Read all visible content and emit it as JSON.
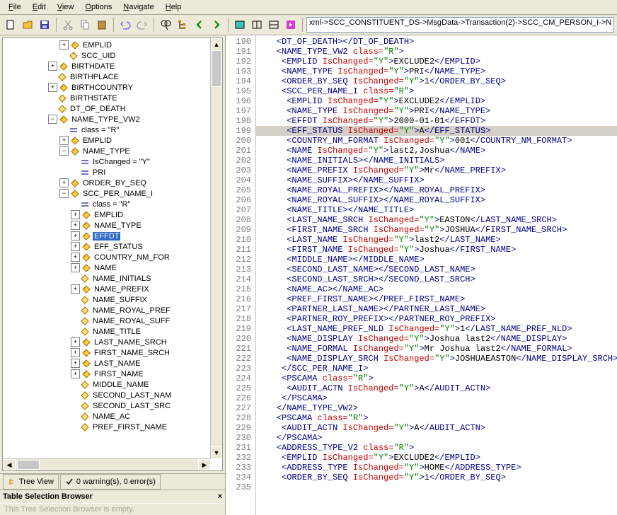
{
  "menubar": [
    "File",
    "Edit",
    "View",
    "Options",
    "Navigate",
    "Help"
  ],
  "breadcrumb": "xml->SCC_CONSTITUENT_DS->MsgData->Transaction(2)->SCC_CM_PERSON_I->N",
  "tree": [
    {
      "indent": 5,
      "tw": "+",
      "ic": "tag",
      "label": "EMPLID"
    },
    {
      "indent": 5,
      "tw": "",
      "ic": "leaf",
      "label": "SCC_UID"
    },
    {
      "indent": 4,
      "tw": "+",
      "ic": "tag",
      "label": "BIRTHDATE"
    },
    {
      "indent": 4,
      "tw": "",
      "ic": "leaf",
      "label": "BIRTHPLACE"
    },
    {
      "indent": 4,
      "tw": "+",
      "ic": "tag",
      "label": "BIRTHCOUNTRY"
    },
    {
      "indent": 4,
      "tw": "",
      "ic": "leaf",
      "label": "BIRTHSTATE"
    },
    {
      "indent": 4,
      "tw": "",
      "ic": "leaf",
      "label": "DT_OF_DEATH"
    },
    {
      "indent": 4,
      "tw": "-",
      "ic": "tag",
      "label": "NAME_TYPE_VW2"
    },
    {
      "indent": 5,
      "tw": "",
      "ic": "eq",
      "label": "class = \"R\""
    },
    {
      "indent": 5,
      "tw": "+",
      "ic": "tag",
      "label": "EMPLID"
    },
    {
      "indent": 5,
      "tw": "-",
      "ic": "tag",
      "label": "NAME_TYPE"
    },
    {
      "indent": 6,
      "tw": "",
      "ic": "eq",
      "label": "IsChanged = \"Y\""
    },
    {
      "indent": 6,
      "tw": "",
      "ic": "eq",
      "label": "PRI"
    },
    {
      "indent": 5,
      "tw": "+",
      "ic": "tag",
      "label": "ORDER_BY_SEQ"
    },
    {
      "indent": 5,
      "tw": "-",
      "ic": "tag",
      "label": "SCC_PER_NAME_I"
    },
    {
      "indent": 6,
      "tw": "",
      "ic": "eq",
      "label": "class = \"R\""
    },
    {
      "indent": 6,
      "tw": "+",
      "ic": "tag",
      "label": "EMPLID"
    },
    {
      "indent": 6,
      "tw": "+",
      "ic": "tag",
      "label": "NAME_TYPE"
    },
    {
      "indent": 6,
      "tw": "+",
      "ic": "tag",
      "label": "EFFDT",
      "sel": true
    },
    {
      "indent": 6,
      "tw": "+",
      "ic": "tag",
      "label": "EFF_STATUS"
    },
    {
      "indent": 6,
      "tw": "+",
      "ic": "tag",
      "label": "COUNTRY_NM_FOR"
    },
    {
      "indent": 6,
      "tw": "+",
      "ic": "tag",
      "label": "NAME"
    },
    {
      "indent": 6,
      "tw": "",
      "ic": "leaf",
      "label": "NAME_INITIALS"
    },
    {
      "indent": 6,
      "tw": "+",
      "ic": "tag",
      "label": "NAME_PREFIX"
    },
    {
      "indent": 6,
      "tw": "",
      "ic": "leaf",
      "label": "NAME_SUFFIX"
    },
    {
      "indent": 6,
      "tw": "",
      "ic": "leaf",
      "label": "NAME_ROYAL_PREF"
    },
    {
      "indent": 6,
      "tw": "",
      "ic": "leaf",
      "label": "NAME_ROYAL_SUFF"
    },
    {
      "indent": 6,
      "tw": "",
      "ic": "leaf",
      "label": "NAME_TITLE"
    },
    {
      "indent": 6,
      "tw": "+",
      "ic": "tag",
      "label": "LAST_NAME_SRCH"
    },
    {
      "indent": 6,
      "tw": "+",
      "ic": "tag",
      "label": "FIRST_NAME_SRCH"
    },
    {
      "indent": 6,
      "tw": "+",
      "ic": "tag",
      "label": "LAST_NAME"
    },
    {
      "indent": 6,
      "tw": "+",
      "ic": "tag",
      "label": "FIRST_NAME"
    },
    {
      "indent": 6,
      "tw": "",
      "ic": "leaf",
      "label": "MIDDLE_NAME"
    },
    {
      "indent": 6,
      "tw": "",
      "ic": "leaf",
      "label": "SECOND_LAST_NAM"
    },
    {
      "indent": 6,
      "tw": "",
      "ic": "leaf",
      "label": "SECOND_LAST_SRC"
    },
    {
      "indent": 6,
      "tw": "",
      "ic": "leaf",
      "label": "NAME_AC"
    },
    {
      "indent": 6,
      "tw": "",
      "ic": "leaf",
      "label": "PREF_FIRST_NAME"
    }
  ],
  "tabs": {
    "treeview": "Tree View",
    "warnings": "0 warning(s), 0 error(s)"
  },
  "tsb": {
    "title": "Table Selection Browser",
    "body": "This Tree Selection Browser is empty."
  },
  "line_start": 190,
  "line_count": 46,
  "code": [
    "    <DT_OF_DEATH></DT_OF_DEATH>",
    "    <NAME_TYPE_VW2 class=\"R\">",
    "     <EMPLID IsChanged=\"Y\">EXCLUDE2</EMPLID>",
    "     <NAME_TYPE IsChanged=\"Y\">PRI</NAME_TYPE>",
    "     <ORDER_BY_SEQ IsChanged=\"Y\">1</ORDER_BY_SEQ>",
    "     <SCC_PER_NAME_I class=\"R\">",
    "      <EMPLID IsChanged=\"Y\">EXCLUDE2</EMPLID>",
    "      <NAME_TYPE IsChanged=\"Y\">PRI</NAME_TYPE>",
    "      <EFFDT IsChanged=\"Y\">2000-01-01</EFFDT>",
    "      <EFF_STATUS IsChanged=\"Y\">A</EFF_STATUS>",
    "      <COUNTRY_NM_FORMAT IsChanged=\"Y\">001</COUNTRY_NM_FORMAT>",
    "      <NAME IsChanged=\"Y\">last2,Joshua</NAME>",
    "      <NAME_INITIALS></NAME_INITIALS>",
    "      <NAME_PREFIX IsChanged=\"Y\">Mr</NAME_PREFIX>",
    "      <NAME_SUFFIX></NAME_SUFFIX>",
    "      <NAME_ROYAL_PREFIX></NAME_ROYAL_PREFIX>",
    "      <NAME_ROYAL_SUFFIX></NAME_ROYAL_SUFFIX>",
    "      <NAME_TITLE></NAME_TITLE>",
    "      <LAST_NAME_SRCH IsChanged=\"Y\">EASTON</LAST_NAME_SRCH>",
    "      <FIRST_NAME_SRCH IsChanged=\"Y\">JOSHUA</FIRST_NAME_SRCH>",
    "      <LAST_NAME IsChanged=\"Y\">last2</LAST_NAME>",
    "      <FIRST_NAME IsChanged=\"Y\">Joshua</FIRST_NAME>",
    "      <MIDDLE_NAME></MIDDLE_NAME>",
    "      <SECOND_LAST_NAME></SECOND_LAST_NAME>",
    "      <SECOND_LAST_SRCH></SECOND_LAST_SRCH>",
    "      <NAME_AC></NAME_AC>",
    "      <PREF_FIRST_NAME></PREF_FIRST_NAME>",
    "      <PARTNER_LAST_NAME></PARTNER_LAST_NAME>",
    "      <PARTNER_ROY_PREFIX></PARTNER_ROY_PREFIX>",
    "      <LAST_NAME_PREF_NLD IsChanged=\"Y\">1</LAST_NAME_PREF_NLD>",
    "      <NAME_DISPLAY IsChanged=\"Y\">Joshua last2</NAME_DISPLAY>",
    "      <NAME_FORMAL IsChanged=\"Y\">Mr Joshua last2</NAME_FORMAL>",
    "      <NAME_DISPLAY_SRCH IsChanged=\"Y\">JOSHUAEASTON</NAME_DISPLAY_SRCH>",
    "     </SCC_PER_NAME_I>",
    "     <PSCAMA class=\"R\">",
    "      <AUDIT_ACTN IsChanged=\"Y\">A</AUDIT_ACTN>",
    "     </PSCAMA>",
    "    </NAME_TYPE_VW2>",
    "    <PSCAMA class=\"R\">",
    "     <AUDIT_ACTN IsChanged=\"Y\">A</AUDIT_ACTN>",
    "    </PSCAMA>",
    "    <ADDRESS_TYPE_V2 class=\"R\">",
    "     <EMPLID IsChanged=\"Y\">EXCLUDE2</EMPLID>",
    "     <ADDRESS_TYPE IsChanged=\"Y\">HOME</ADDRESS_TYPE>",
    "     <ORDER_BY_SEQ IsChanged=\"Y\">1</ORDER_BY_SEQ>",
    ""
  ],
  "highlight_line": 199
}
